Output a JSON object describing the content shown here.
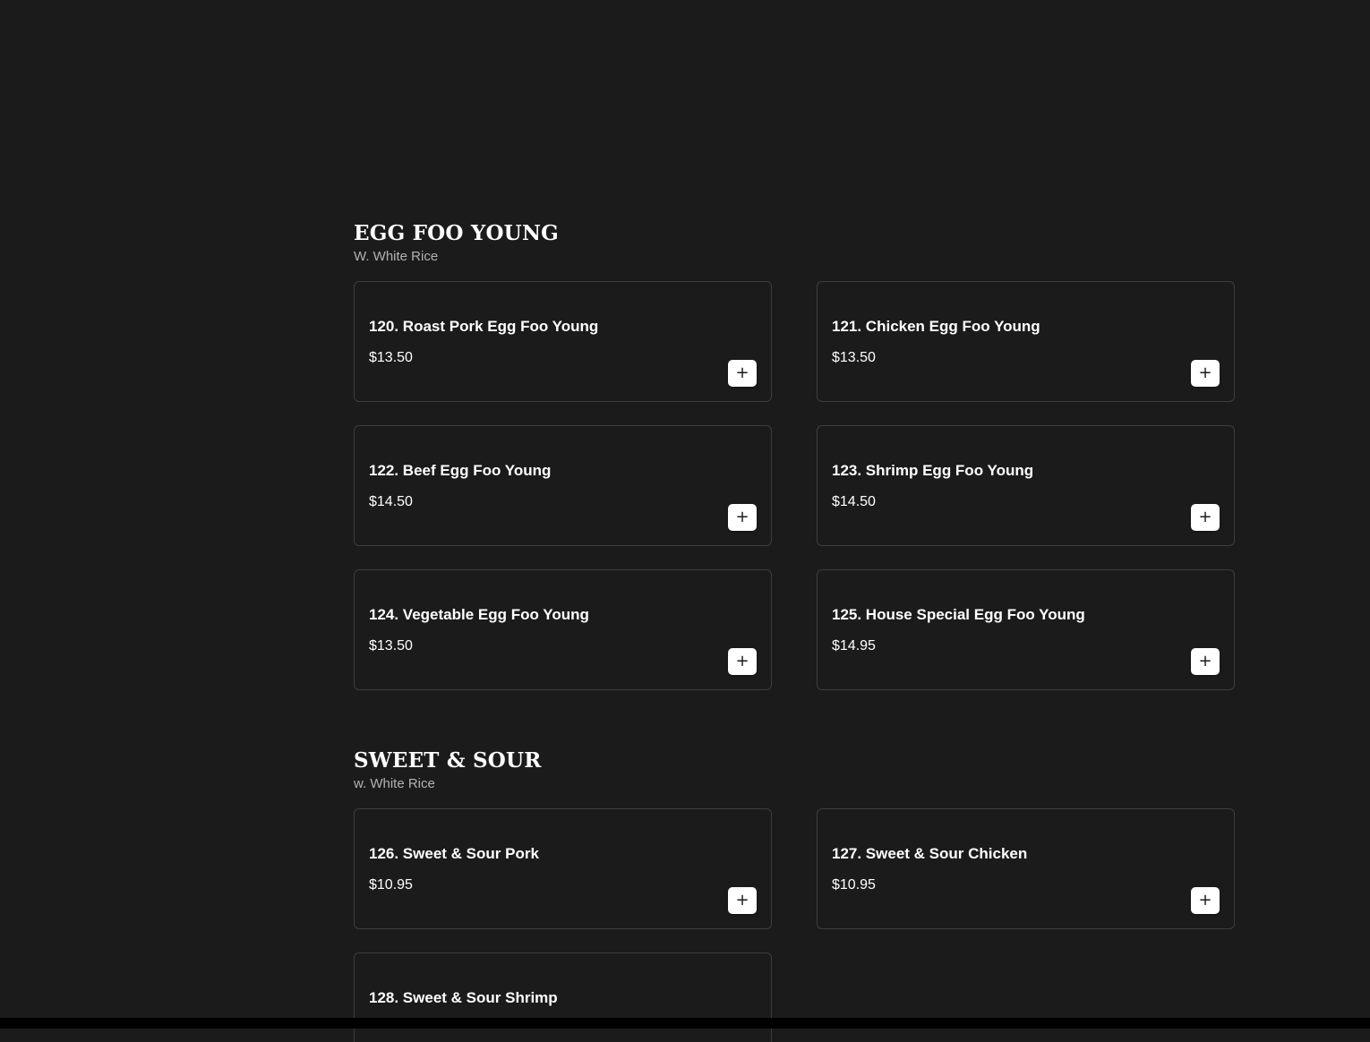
{
  "sections": [
    {
      "title": "EGG FOO YOUNG",
      "subtitle": "W. White Rice",
      "items": [
        {
          "name": "120. Roast Pork Egg Foo Young",
          "price": "$13.50",
          "add": "+"
        },
        {
          "name": "121. Chicken Egg Foo Young",
          "price": "$13.50",
          "add": "+"
        },
        {
          "name": "122. Beef Egg Foo Young",
          "price": "$14.50",
          "add": "+"
        },
        {
          "name": "123. Shrimp Egg Foo Young",
          "price": "$14.50",
          "add": "+"
        },
        {
          "name": "124. Vegetable Egg Foo Young",
          "price": "$13.50",
          "add": "+"
        },
        {
          "name": "125. House Special Egg Foo Young",
          "price": "$14.95",
          "add": "+"
        }
      ]
    },
    {
      "title": "SWEET & SOUR",
      "subtitle": "w. White Rice",
      "items": [
        {
          "name": "126. Sweet & Sour Pork",
          "price": "$10.95",
          "add": "+"
        },
        {
          "name": "127. Sweet & Sour Chicken",
          "price": "$10.95",
          "add": "+"
        },
        {
          "name": "128. Sweet & Sour Shrimp"
        }
      ]
    }
  ]
}
